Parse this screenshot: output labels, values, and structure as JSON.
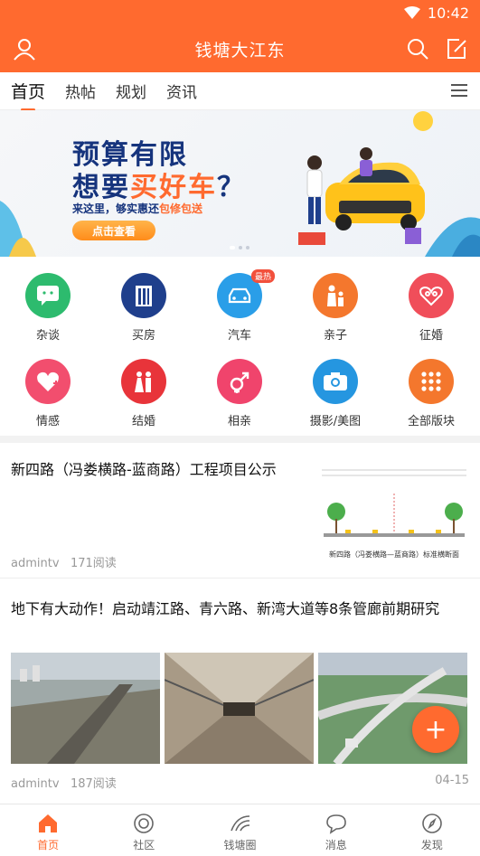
{
  "status_bar": {
    "time": "10:42"
  },
  "app_bar": {
    "title": "钱塘大江东"
  },
  "tabs": [
    {
      "label": "首页",
      "active": true
    },
    {
      "label": "热帖",
      "active": false
    },
    {
      "label": "规划",
      "active": false
    },
    {
      "label": "资讯",
      "active": false
    }
  ],
  "banner": {
    "line1": "预算有限",
    "line2_pre": "想要",
    "line2_highlight": "买好车",
    "line2_post": "？",
    "sub_pre": "来这里，够实惠还",
    "sub_highlight": "包修包送",
    "cta": "点击查看"
  },
  "categories": [
    {
      "label": "杂谈",
      "icon": "chat-icon",
      "color": "#2dbb6e"
    },
    {
      "label": "买房",
      "icon": "building-icon",
      "color": "#1f3f8c"
    },
    {
      "label": "汽车",
      "icon": "car-icon",
      "color": "#2a9ee8",
      "badge": "最热"
    },
    {
      "label": "亲子",
      "icon": "family-icon",
      "color": "#f4772d"
    },
    {
      "label": "征婚",
      "icon": "couple-icon",
      "color": "#f04e5a"
    },
    {
      "label": "情感",
      "icon": "heart-icon",
      "color": "#f24e6e"
    },
    {
      "label": "结婚",
      "icon": "wedding-icon",
      "color": "#e8343a"
    },
    {
      "label": "相亲",
      "icon": "gender-icon",
      "color": "#f0446c"
    },
    {
      "label": "摄影/美图",
      "icon": "camera-icon",
      "color": "#2596e0"
    },
    {
      "label": "全部版块",
      "icon": "grid-icon",
      "color": "#f4772d"
    }
  ],
  "articles": [
    {
      "title": "新四路（冯娄横路-蓝商路）工程项目公示",
      "author": "admintv",
      "reads": "171阅读",
      "thumb_caption": "新四路（冯娄横路—蓝商路）标准横断面"
    },
    {
      "title": "地下有大动作！启动靖江路、青六路、新湾大道等8条管廊前期研究",
      "author": "admintv",
      "reads": "187阅读",
      "date": "04-15"
    }
  ],
  "fab": {
    "label": "+"
  },
  "bottom_nav": [
    {
      "label": "首页",
      "icon": "home-icon",
      "active": true
    },
    {
      "label": "社区",
      "icon": "community-icon",
      "active": false
    },
    {
      "label": "钱塘圈",
      "icon": "wave-icon",
      "active": false
    },
    {
      "label": "消息",
      "icon": "message-icon",
      "active": false
    },
    {
      "label": "发现",
      "icon": "compass-icon",
      "active": false
    }
  ],
  "colors": {
    "brand": "#ff6a2f"
  }
}
